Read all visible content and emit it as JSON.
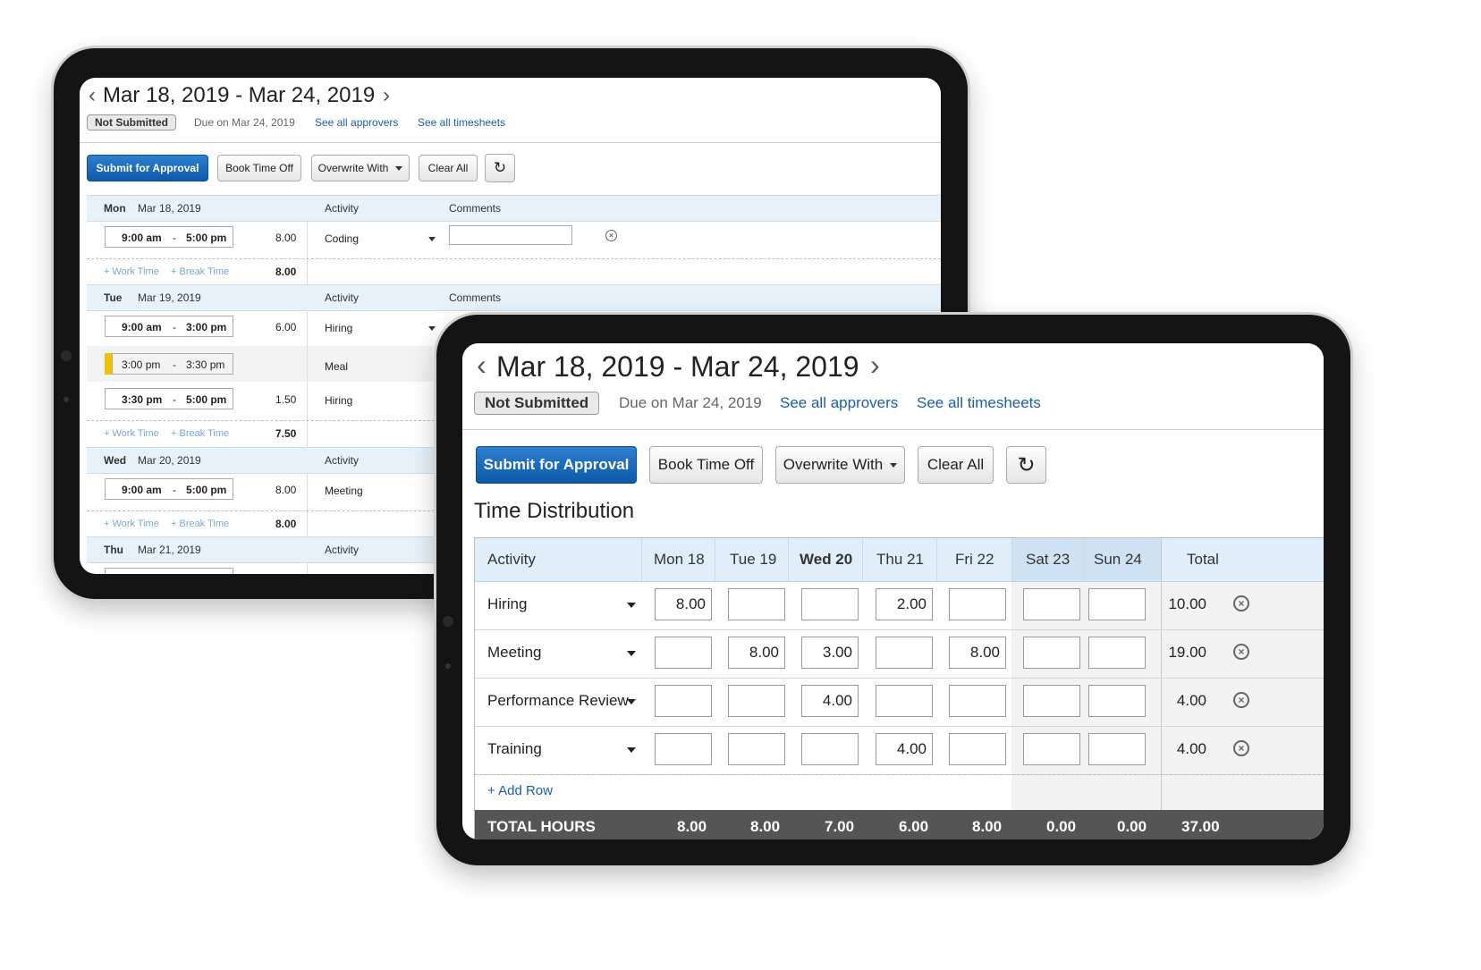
{
  "back_sheet": {
    "date_range": "Mar 18, 2019 - Mar 24, 2019",
    "status": "Not Submitted",
    "due": "Due on Mar 24, 2019",
    "see_approvers": "See all approvers",
    "see_timesheets": "See all timesheets",
    "toolbar": {
      "submit": "Submit for Approval",
      "book_time_off": "Book Time Off",
      "overwrite_with": "Overwrite With",
      "clear_all": "Clear All"
    },
    "col_activity": "Activity",
    "col_comments": "Comments",
    "add_work_time": "+ Work Time",
    "add_break_time": "+ Break Time",
    "days": [
      {
        "dow": "Mon",
        "date": "Mar 18, 2019",
        "total": "8.00",
        "entries": [
          {
            "start": "9:00 am",
            "sep": "-",
            "end": "5:00 pm",
            "hours": "8.00",
            "activity": "Coding"
          }
        ]
      },
      {
        "dow": "Tue",
        "date": "Mar 19, 2019",
        "total": "7.50",
        "entries": [
          {
            "start": "9:00 am",
            "sep": "-",
            "end": "3:00 pm",
            "hours": "6.00",
            "activity": "Hiring"
          },
          {
            "start": "3:00 pm",
            "sep": "-",
            "end": "3:30 pm",
            "hours": "",
            "activity": "Meal"
          },
          {
            "start": "3:30 pm",
            "sep": "-",
            "end": "5:00 pm",
            "hours": "1.50",
            "activity": "Hiring"
          }
        ]
      },
      {
        "dow": "Wed",
        "date": "Mar 20, 2019",
        "total": "8.00",
        "entries": [
          {
            "start": "9:00 am",
            "sep": "-",
            "end": "5:00 pm",
            "hours": "8.00",
            "activity": "Meeting"
          }
        ]
      },
      {
        "dow": "Thu",
        "date": "Mar 21, 2019"
      }
    ]
  },
  "front_sheet": {
    "date_range": "Mar 18, 2019 - Mar 24, 2019",
    "status": "Not Submitted",
    "due": "Due on Mar 24, 2019",
    "see_approvers": "See all approvers",
    "see_timesheets": "See all timesheets",
    "toolbar": {
      "submit": "Submit for Approval",
      "book_time_off": "Book Time Off",
      "overwrite_with": "Overwrite With",
      "clear_all": "Clear All"
    },
    "section_title": "Time Distribution",
    "columns": [
      "Activity",
      "Mon 18",
      "Tue 19",
      "Wed 20",
      "Thu 21",
      "Fri 22",
      "Sat 23",
      "Sun 24",
      "Total"
    ],
    "rows": [
      {
        "activity": "Hiring",
        "values": [
          "8.00",
          "",
          "",
          "2.00",
          "",
          "",
          ""
        ],
        "total": "10.00"
      },
      {
        "activity": "Meeting",
        "values": [
          "",
          "8.00",
          "3.00",
          "",
          "8.00",
          "",
          ""
        ],
        "total": "19.00"
      },
      {
        "activity": "Performance Review",
        "values": [
          "",
          "",
          "4.00",
          "",
          "",
          "",
          ""
        ],
        "total": "4.00"
      },
      {
        "activity": "Training",
        "values": [
          "",
          "",
          "",
          "4.00",
          "",
          "",
          ""
        ],
        "total": "4.00"
      }
    ],
    "add_row": "+ Add Row",
    "totals": {
      "label": "TOTAL HOURS",
      "values": [
        "8.00",
        "8.00",
        "7.00",
        "6.00",
        "8.00",
        "0.00",
        "0.00"
      ],
      "total": "37.00"
    }
  },
  "icons": {
    "prev": "chevron-left-icon",
    "next": "chevron-right-icon",
    "refresh": "refresh-icon",
    "remove": "close-circle-icon"
  }
}
